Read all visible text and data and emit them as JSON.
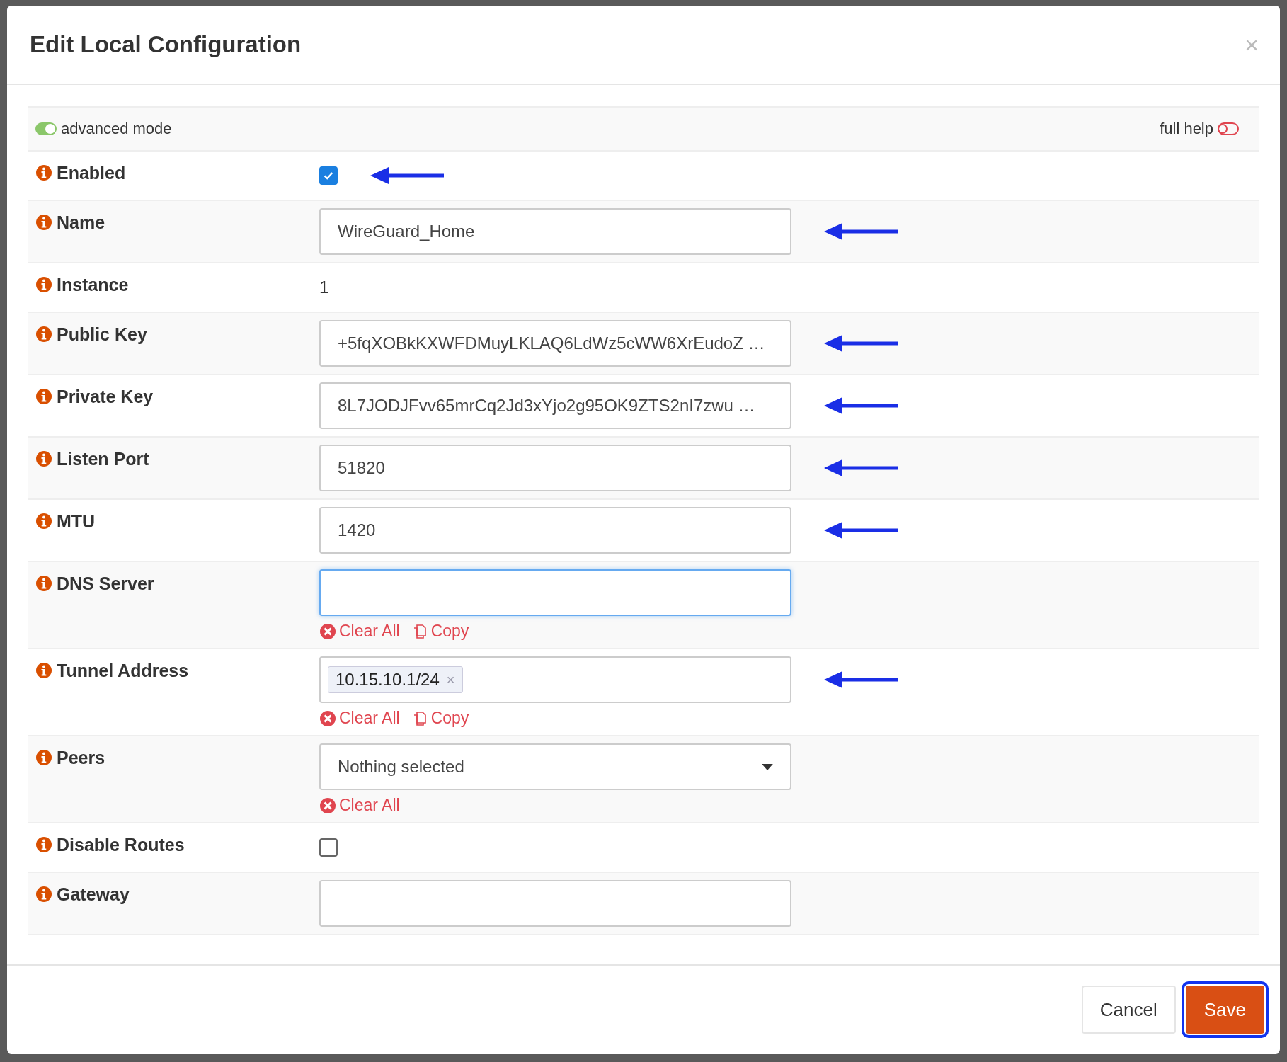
{
  "dialog": {
    "title": "Edit Local Configuration",
    "close": "×"
  },
  "mode_bar": {
    "advanced": {
      "label": "advanced mode",
      "on": true
    },
    "full_help": {
      "label": "full help",
      "on": false
    }
  },
  "rows": [
    {
      "label": "Enabled",
      "kind": "checkbox",
      "checked": true,
      "marked": true
    },
    {
      "label": "Name",
      "kind": "text",
      "value": "WireGuard_Home",
      "focused": false,
      "marked": true
    },
    {
      "label": "Instance",
      "kind": "static",
      "value": "1",
      "marked": false
    },
    {
      "label": "Public Key",
      "kind": "text",
      "value": "+5fqXOBkKXWFDMuyLKLAQ6LdWz5cWW6XrEudoZ …",
      "focused": false,
      "marked": true
    },
    {
      "label": "Private Key",
      "kind": "text",
      "value": "8L7JODJFvv65mrCq2Jd3xYjo2g95OK9ZTS2nI7zwu …",
      "focused": false,
      "marked": true
    },
    {
      "label": "Listen Port",
      "kind": "text",
      "value": "51820",
      "focused": false,
      "marked": true
    },
    {
      "label": "MTU",
      "kind": "text",
      "value": "1420",
      "focused": false,
      "marked": true
    },
    {
      "label": "DNS Server",
      "kind": "tokens",
      "tokens": [],
      "focused": true,
      "marked": false,
      "actions": [
        {
          "kind": "clear",
          "label": "Clear All"
        },
        {
          "kind": "copy",
          "label": "Copy"
        }
      ]
    },
    {
      "label": "Tunnel Address",
      "kind": "tokens",
      "tokens": [
        {
          "text": "10.15.10.1/24",
          "remove": "×"
        }
      ],
      "focused": false,
      "marked": true,
      "actions": [
        {
          "kind": "clear",
          "label": "Clear All"
        },
        {
          "kind": "copy",
          "label": "Copy"
        }
      ]
    },
    {
      "label": "Peers",
      "kind": "select",
      "value": "Nothing selected",
      "marked": false,
      "actions": [
        {
          "kind": "clear",
          "label": "Clear All"
        }
      ]
    },
    {
      "label": "Disable Routes",
      "kind": "checkbox",
      "checked": false,
      "marked": false
    },
    {
      "label": "Gateway",
      "kind": "text",
      "value": "",
      "focused": false,
      "marked": false
    }
  ],
  "buttons": [
    {
      "label": "Cancel",
      "kind": "default",
      "focused": false
    },
    {
      "label": "Save",
      "kind": "primary",
      "focused": true
    }
  ]
}
